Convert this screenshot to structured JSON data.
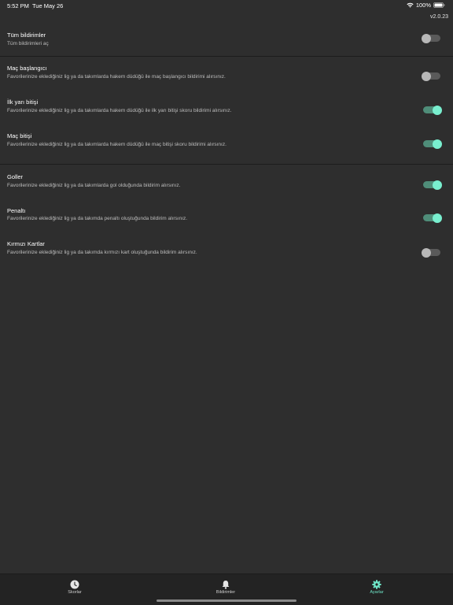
{
  "status_bar": {
    "time": "5:52 PM",
    "date": "Tue May 26",
    "battery": "100%"
  },
  "version": "v2.0.23",
  "settings": [
    {
      "title": "Tüm bildirimler",
      "description": "Tüm bildirimleri aç",
      "enabled": false
    },
    {
      "title": "Maç başlangıcı",
      "description": "Favorilerinize eklediğiniz lig ya da takımlarda hakem düdüğü ile maç başlangıcı bildirimi alırsınız.",
      "enabled": false
    },
    {
      "title": "İlk yarı bitişi",
      "description": "Favorilerinize eklediğiniz lig ya da takımlarda hakem düdüğü ile ilk yarı bitişi skoru bildirimi alırsınız.",
      "enabled": true
    },
    {
      "title": "Maç bitişi",
      "description": "Favorilerinize eklediğiniz lig ya da takımlarda hakem düdüğü ile maç bitişi skoru bildirimi alırsınız.",
      "enabled": true
    },
    {
      "title": "Goller",
      "description": "Favorilerinize eklediğiniz lig ya da takımlarda gol olduğunda bildirim alırsınız.",
      "enabled": true
    },
    {
      "title": "Penaltı",
      "description": "Favorilerinize eklediğiniz lig ya da takımda penaltı oluştuğunda bildirim alırsınız.",
      "enabled": true
    },
    {
      "title": "Kırmızı Kartlar",
      "description": "Favorilerinize eklediğiniz lig ya da takımda kırmızı kart oluştuğunda bildirim alırsınız.",
      "enabled": false
    }
  ],
  "tabs": [
    {
      "label": "Skorlar",
      "icon": "clock-icon",
      "active": false
    },
    {
      "label": "Bildirimler",
      "icon": "bell-icon",
      "active": false
    },
    {
      "label": "Ayarlar",
      "icon": "gear-icon",
      "active": true
    }
  ],
  "colors": {
    "background": "#2e2e2e",
    "tabbar": "#232323",
    "accent": "#6fe6c8",
    "toggle_on_track": "#4f8d79",
    "toggle_off_track": "#5a5a5a"
  }
}
